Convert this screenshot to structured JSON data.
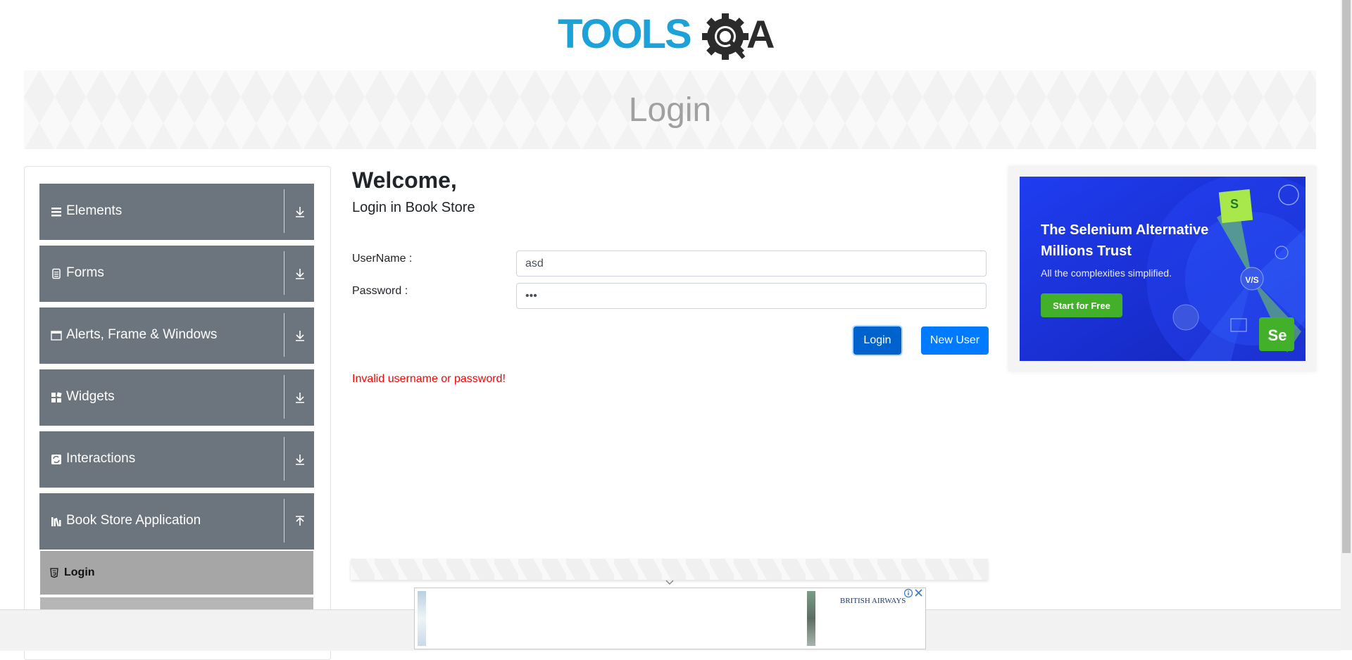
{
  "header": {
    "logo_text": "TOOLSQA"
  },
  "banner": {
    "title": "Login"
  },
  "sidebar": {
    "groups": [
      {
        "label": "Elements",
        "icon": "list-icon"
      },
      {
        "label": "Forms",
        "icon": "document-icon"
      },
      {
        "label": "Alerts, Frame & Windows",
        "icon": "window-icon"
      },
      {
        "label": "Widgets",
        "icon": "widgets-icon"
      },
      {
        "label": "Interactions",
        "icon": "interactions-icon"
      },
      {
        "label": "Book Store Application",
        "icon": "books-icon"
      }
    ],
    "sub_items": [
      {
        "label": "Login",
        "icon": "html5-icon"
      }
    ]
  },
  "form": {
    "welcome": "Welcome,",
    "subtitle": "Login in Book Store",
    "username_label": "UserName :",
    "username_value": "asd",
    "password_label": "Password :",
    "password_value": "•••",
    "login_button": "Login",
    "new_user_button": "New User",
    "error": "Invalid username or password!"
  },
  "ad_right": {
    "title_line1": "The Selenium Alternative",
    "title_line2": "Millions Trust",
    "subtitle": "All the complexities simplified.",
    "cta": "Start for Free",
    "badge_s": "S",
    "badge_vs": "V/S",
    "badge_se": "Se"
  },
  "ad_bottom": {
    "brand": "BRITISH AIRWAYS"
  },
  "colors": {
    "sidebar_group_bg": "#6c757d",
    "sidebar_sub_bg": "#a6a6a6",
    "primary": "#007bff",
    "primary_active": "#0062cc",
    "error": "#ff0000",
    "logo_blue": "#1da1d9",
    "logo_dark": "#2b2b2b",
    "ad_blue": "#1a2fe0",
    "ad_green": "#43b02a"
  }
}
